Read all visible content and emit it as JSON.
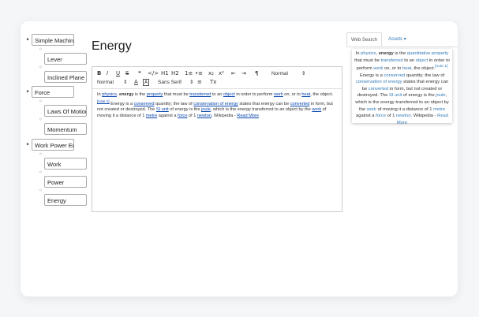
{
  "page": {
    "title": "Energy"
  },
  "tree": {
    "nodes": [
      {
        "label": "Simple Machines",
        "children": [
          "Lever",
          "Inclined Plane"
        ]
      },
      {
        "label": "Force",
        "children": [
          "Laws Of Motion",
          "Momentum"
        ]
      },
      {
        "label": "Work Power Energy",
        "children": [
          "Work",
          "Power",
          "Energy"
        ]
      }
    ]
  },
  "toolbar": {
    "bold": "B",
    "italic": "I",
    "underline": "U",
    "strike": "S",
    "quote": "❝",
    "code": "</>",
    "h1": "H1",
    "h2": "H2",
    "ol": "1≡",
    "ul": "•≡",
    "sub": "x₂",
    "sup": "x²",
    "outdent": "⇤",
    "indent": "⇥",
    "rtl": "¶",
    "header_select": "Normal",
    "size_select": "Normal",
    "color": "A",
    "background": "A",
    "font_select": "Sans Serif",
    "align": "≡",
    "clean": "Tx"
  },
  "editor": {
    "p1": "In ",
    "physics": "physics",
    "p2": ", ",
    "energy": "energy",
    "p3": " is the ",
    "property": "property",
    "p4": " that must be ",
    "transferred": "transferred",
    "p5": " to an ",
    "object": "object",
    "p6": " in order to perform ",
    "work": "work",
    "p7": " on, or to ",
    "heat": "heat",
    "p8": ", the object.",
    "note": "[note 1]",
    "p9": " Energy is a ",
    "conserved": "conserved",
    "p10": " quantity; the law of ",
    "conservation": "conservation of energy",
    "p11": " states that energy can be ",
    "converted": "converted",
    "p12": " in form, but not created or destroyed. The ",
    "si_unit": "SI unit",
    "p13": " of energy is the ",
    "joule": "joule",
    "p14": ", which is the energy transferred to an object by the ",
    "work2": "work",
    "p15": " of moving it a distance of 1 ",
    "metre": "metre",
    "p16": " against a ",
    "force": "force",
    "p17": " of 1 ",
    "newton": "newton",
    "p18": ". Wikipedia - ",
    "read_more": "Read More"
  },
  "side": {
    "tab_search": "Web Search",
    "tab_assets": "Assets ▾",
    "s1": "In ",
    "physics": "physics",
    "s2": ", ",
    "energy": "energy",
    "s3": " is the ",
    "quant": "quantitative property",
    "s4": " that must be ",
    "transferred": "transferred",
    "s5": " to an ",
    "object": "object",
    "s6": " in order to perform ",
    "work": "work",
    "s7": " on, or to ",
    "heat": "heat",
    "s8": ", the object.",
    "note": "[note 1]",
    "s9": " Energy is a ",
    "conserved": "conserved",
    "s10": " quantity; the law of ",
    "conservation": "conservation of energy",
    "s11": " states that energy can be ",
    "converted": "converted",
    "s12": " in form, but not created or destroyed. The ",
    "si_unit": "SI unit",
    "s13": " of energy is the ",
    "joule": "joule",
    "s14": ", which is the energy transferred to an object by the ",
    "work2": "work",
    "s15": " of moving it a distance of 1 ",
    "metre": "metre",
    "s16": " against a ",
    "force": "force",
    "s17": " of 1 ",
    "newton": "newton",
    "s18": ". Wikipedia - ",
    "read_more": "Read More"
  }
}
